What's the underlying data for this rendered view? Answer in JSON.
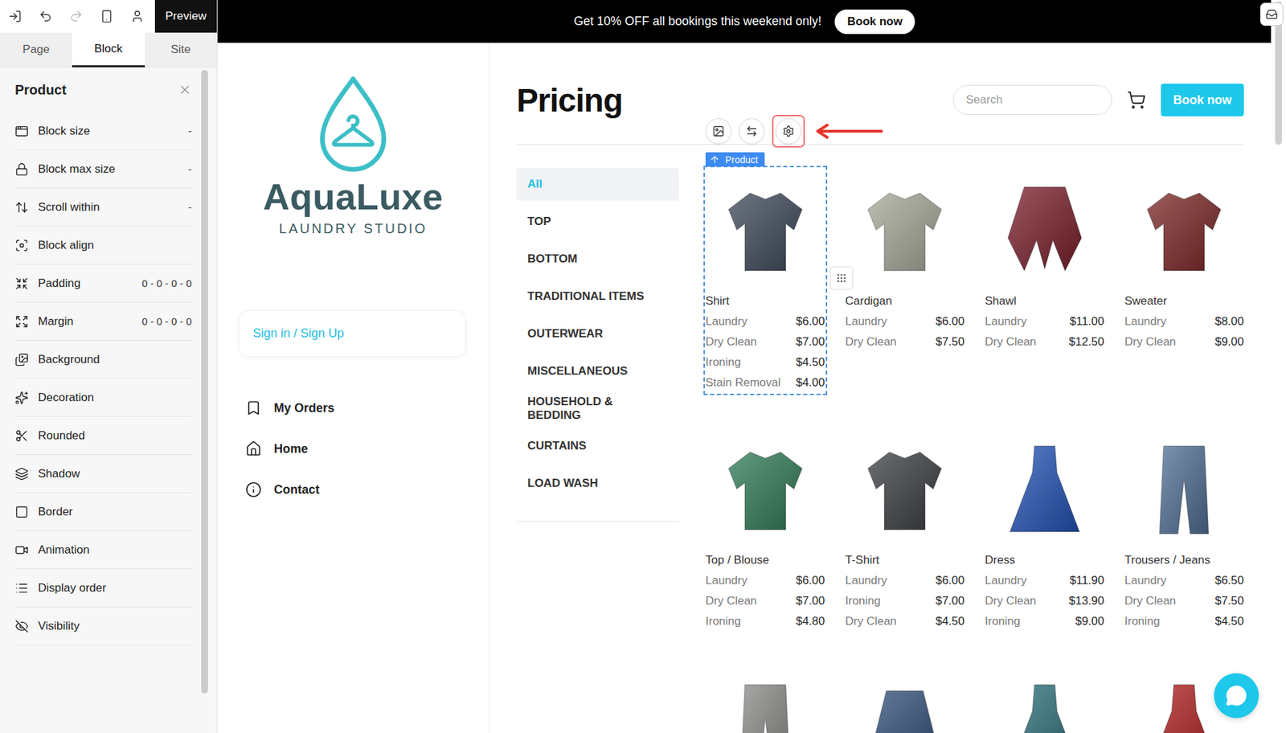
{
  "editor": {
    "preview": "Preview",
    "tabs": [
      {
        "label": "Page",
        "selected": false
      },
      {
        "label": "Block",
        "selected": true
      },
      {
        "label": "Site",
        "selected": false
      }
    ],
    "panel_title": "Product",
    "settings": [
      {
        "label": "Block size",
        "value": "-"
      },
      {
        "label": "Block max size",
        "value": "-"
      },
      {
        "label": "Scroll within",
        "value": "-"
      },
      {
        "label": "Block align"
      },
      {
        "label": "Padding",
        "value": "0 - 0 - 0 - 0"
      },
      {
        "label": "Margin",
        "value": "0 - 0 - 0 - 0"
      },
      {
        "label": "Background"
      },
      {
        "label": "Decoration"
      },
      {
        "label": "Rounded"
      },
      {
        "label": "Shadow"
      },
      {
        "label": "Border"
      },
      {
        "label": "Animation"
      },
      {
        "label": "Display order"
      },
      {
        "label": "Visibility"
      }
    ]
  },
  "banner": {
    "text": "Get 10% OFF all bookings this weekend only!",
    "button": "Book now"
  },
  "site": {
    "logo": {
      "name": "AquaLuxe",
      "tagline": "LAUNDRY STUDIO"
    },
    "sign_in": "Sign in / Sign Up",
    "nav": [
      "My Orders",
      "Home",
      "Contact"
    ]
  },
  "page": {
    "title": "Pricing",
    "search_placeholder": "Search",
    "book_button": "Book now"
  },
  "categories": [
    {
      "label": "All",
      "selected": true
    },
    {
      "label": "TOP",
      "selected": false
    },
    {
      "label": "BOTTOM",
      "selected": false
    },
    {
      "label": "TRADITIONAL ITEMS",
      "selected": false
    },
    {
      "label": "OUTERWEAR",
      "selected": false
    },
    {
      "label": "MISCELLANEOUS",
      "selected": false
    },
    {
      "label": "HOUSEHOLD & BEDDING",
      "selected": false
    },
    {
      "label": "CURTAINS",
      "selected": false
    },
    {
      "label": "LOAD WASH",
      "selected": false
    }
  ],
  "block_toolbar": [
    {
      "kind": "image",
      "highlighted": false
    },
    {
      "kind": "swap",
      "highlighted": false
    },
    {
      "kind": "settings",
      "highlighted": true
    }
  ],
  "selection_tag": "Product",
  "products": [
    {
      "name": "Shirt",
      "kind": "top",
      "color": "#3d4859",
      "selected": true,
      "prices": [
        {
          "service": "Laundry",
          "price": "$6.00"
        },
        {
          "service": "Dry Clean",
          "price": "$7.00"
        },
        {
          "service": "Ironing",
          "price": "$4.50"
        },
        {
          "service": "Stain Removal",
          "price": "$4.00"
        }
      ]
    },
    {
      "name": "Cardigan",
      "kind": "top",
      "color": "#a7a898",
      "selected": false,
      "prices": [
        {
          "service": "Laundry",
          "price": "$6.00"
        },
        {
          "service": "Dry Clean",
          "price": "$7.50"
        }
      ]
    },
    {
      "name": "Shawl",
      "kind": "shawl",
      "color": "#7a1f2a",
      "selected": false,
      "prices": [
        {
          "service": "Laundry",
          "price": "$11.00"
        },
        {
          "service": "Dry Clean",
          "price": "$12.50"
        }
      ]
    },
    {
      "name": "Sweater",
      "kind": "top",
      "color": "#7b2626",
      "selected": false,
      "prices": [
        {
          "service": "Laundry",
          "price": "$8.00"
        },
        {
          "service": "Dry Clean",
          "price": "$9.00"
        }
      ]
    },
    {
      "name": "Top / Blouse",
      "kind": "top",
      "color": "#2f7a55",
      "selected": false,
      "prices": [
        {
          "service": "Laundry",
          "price": "$6.00"
        },
        {
          "service": "Dry Clean",
          "price": "$7.00"
        },
        {
          "service": "Ironing",
          "price": "$4.80"
        }
      ]
    },
    {
      "name": "T-Shirt",
      "kind": "top",
      "color": "#3a3d42",
      "selected": false,
      "prices": [
        {
          "service": "Laundry",
          "price": "$6.00"
        },
        {
          "service": "Ironing",
          "price": "$7.00"
        },
        {
          "service": "Dry Clean",
          "price": "$4.50"
        }
      ]
    },
    {
      "name": "Dress",
      "kind": "dress",
      "color": "#2352b5",
      "selected": false,
      "prices": [
        {
          "service": "Laundry",
          "price": "$11.90"
        },
        {
          "service": "Dry Clean",
          "price": "$13.90"
        },
        {
          "service": "Ironing",
          "price": "$9.00"
        }
      ]
    },
    {
      "name": "Trousers / Jeans",
      "kind": "trousers",
      "color": "#4f6f95",
      "selected": false,
      "prices": [
        {
          "service": "Laundry",
          "price": "$6.50"
        },
        {
          "service": "Dry Clean",
          "price": "$7.50"
        },
        {
          "service": "Ironing",
          "price": "$4.50"
        }
      ]
    }
  ],
  "partial_products": [
    {
      "kind": "trousers",
      "color": "#8a8c88"
    },
    {
      "kind": "skirt",
      "color": "#33507a"
    },
    {
      "kind": "dress",
      "color": "#2c6f7a"
    },
    {
      "kind": "dress",
      "color": "#b0201f"
    }
  ]
}
